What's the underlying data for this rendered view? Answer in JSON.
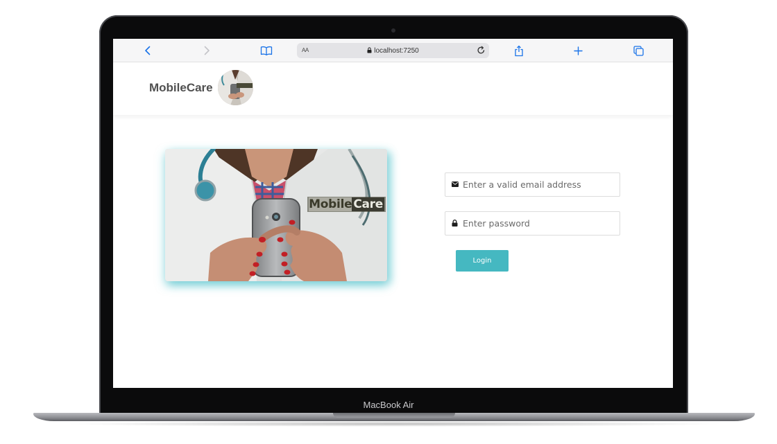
{
  "device": {
    "label": "MacBook Air"
  },
  "browser": {
    "address_aa": "AA",
    "url": "localhost:7250",
    "icons": [
      "back-icon",
      "forward-icon",
      "bookmarks-icon",
      "lock-icon",
      "reload-icon",
      "share-icon",
      "new-tab-icon",
      "tabs-icon"
    ]
  },
  "site": {
    "brand": "MobileCare",
    "hero_label_part1": "Mobile",
    "hero_label_part2": "Care"
  },
  "login": {
    "email_placeholder": "Enter a valid email address",
    "password_placeholder": "Enter password",
    "submit_label": "Login"
  },
  "colors": {
    "accent": "#45b8c1",
    "brand_text": "#505050",
    "browser_blue": "#1a73e8"
  }
}
